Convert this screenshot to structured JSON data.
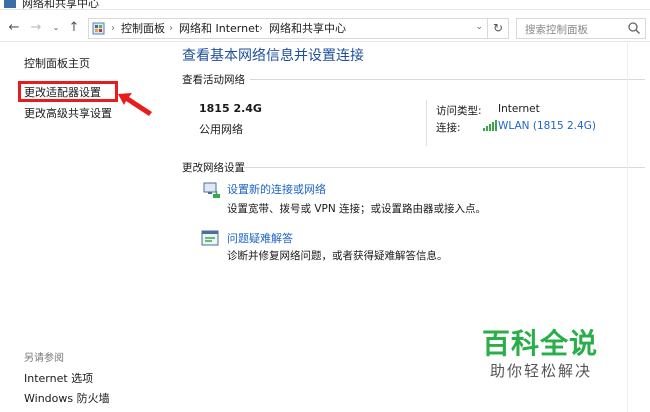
{
  "window": {
    "title": "网络和共享中心"
  },
  "nav": {
    "back_icon": "back-arrow-icon",
    "forward_icon": "forward-arrow-icon",
    "recent_icon": "chevron-down-icon",
    "up_icon": "up-arrow-icon",
    "breadcrumb": [
      "控制面板",
      "网络和 Internet",
      "网络和共享中心"
    ],
    "search_placeholder": "搜索控制面板"
  },
  "sidebar": {
    "items": [
      {
        "label": "控制面板主页"
      },
      {
        "label": "更改适配器设置"
      },
      {
        "label": "更改高级共享设置"
      }
    ],
    "see_also_title": "另请参阅",
    "see_also": [
      {
        "label": "Internet 选项"
      },
      {
        "label": "Windows 防火墙"
      }
    ]
  },
  "main": {
    "heading": "查看基本网络信息并设置连接",
    "active_section_title": "查看活动网络",
    "network": {
      "name": "1815 2.4G",
      "type": "公用网络",
      "access_type_label": "访问类型:",
      "access_type_value": "Internet",
      "connection_label": "连接:",
      "connection_value": "WLAN (1815 2.4G)"
    },
    "change_section_title": "更改网络设置",
    "tasks": [
      {
        "link": "设置新的连接或网络",
        "desc": "设置宽带、拨号或 VPN 连接；或设置路由器或接入点。",
        "icon": "network-setup-icon"
      },
      {
        "link": "问题疑难解答",
        "desc": "诊断并修复网络问题，或者获得疑难解答信息。",
        "icon": "troubleshoot-icon"
      }
    ]
  },
  "watermark": {
    "line1": "百科全说",
    "line2": "助你轻松解决"
  },
  "colors": {
    "link": "#1e64c8",
    "heading": "#1e4f9c",
    "highlight": "#e81c1c",
    "watermark_green": "#2aae4a"
  }
}
